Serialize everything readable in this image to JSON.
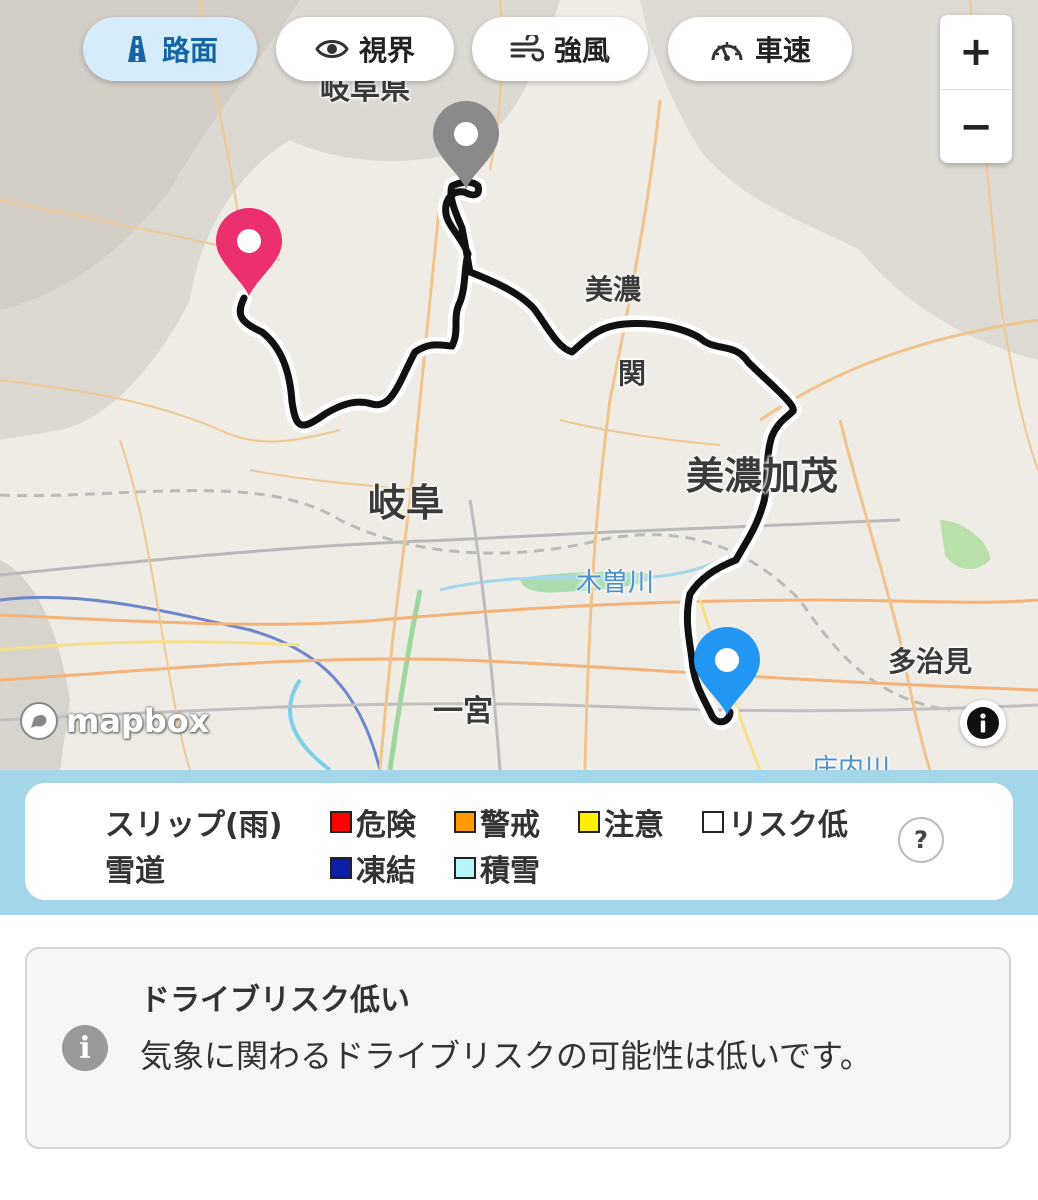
{
  "layers": {
    "road": "路面",
    "visibility": "視界",
    "wind": "強風",
    "speed": "車速",
    "active": "road"
  },
  "zoom": {
    "in": "+",
    "out": "−"
  },
  "map": {
    "places": {
      "prefecture": "岐阜県",
      "mino": "美濃",
      "seki": "関",
      "gifu": "岐阜",
      "minokamo": "美濃加茂",
      "kisogawa": "木曽川",
      "tajimi": "多治見",
      "ichinomiya": "一宮",
      "shonaigawa": "庄内川"
    },
    "attribution": "mapbox",
    "markers": [
      {
        "name": "pink-marker",
        "color": "#ec2f6e"
      },
      {
        "name": "gray-marker",
        "color": "#8a8a8a"
      },
      {
        "name": "blue-marker",
        "color": "#2196f3"
      }
    ],
    "route_color": "#111111"
  },
  "legend": {
    "slip_title": "スリップ(雨)",
    "snow_title": "雪道",
    "items": [
      {
        "label": "危険",
        "color": "#ff0000"
      },
      {
        "label": "警戒",
        "color": "#ff9900"
      },
      {
        "label": "注意",
        "color": "#ffee00"
      },
      {
        "label": "リスク低",
        "color": "#ffffff"
      },
      {
        "label": "凍結",
        "color": "#0a1fa6"
      },
      {
        "label": "積雪",
        "color": "#b6f5f8"
      }
    ],
    "help": "?"
  },
  "risk": {
    "icon": "i",
    "title": "ドライブリスク低い",
    "message": "気象に関わるドライブリスクの可能性は低いです。"
  }
}
